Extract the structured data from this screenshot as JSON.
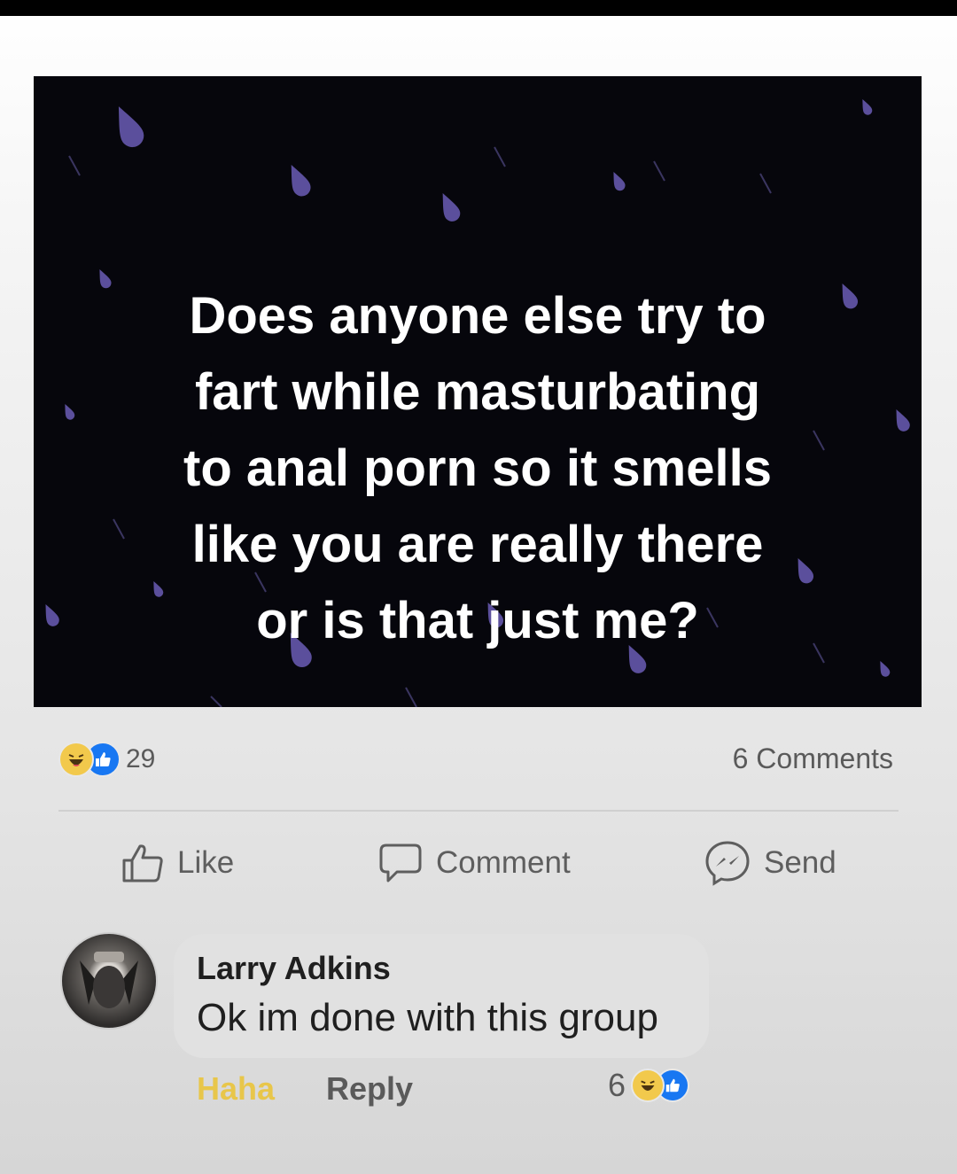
{
  "post": {
    "image_text": "Does anyone else try to\nfart while masturbating\nto anal porn so it smells\nlike you are really there\nor is that just me?"
  },
  "reactions": {
    "types": [
      "haha",
      "like"
    ],
    "count": "29"
  },
  "comments_count": "6 Comments",
  "actions": {
    "like": "Like",
    "comment": "Comment",
    "send": "Send"
  },
  "comment": {
    "author": "Larry Adkins",
    "text": "Ok im done with this group",
    "haha_label": "Haha",
    "reply_label": "Reply",
    "reaction_count": "6"
  },
  "colors": {
    "image_background": "#06060c",
    "raindrop": "#5b4f9c",
    "like_blue": "#1877f2",
    "haha_yellow": "#f2c94c",
    "muted_text": "#5a5a5a"
  },
  "icons": [
    "haha-reaction-icon",
    "like-reaction-icon",
    "thumbs-up-icon",
    "speech-bubble-icon",
    "messenger-icon"
  ]
}
